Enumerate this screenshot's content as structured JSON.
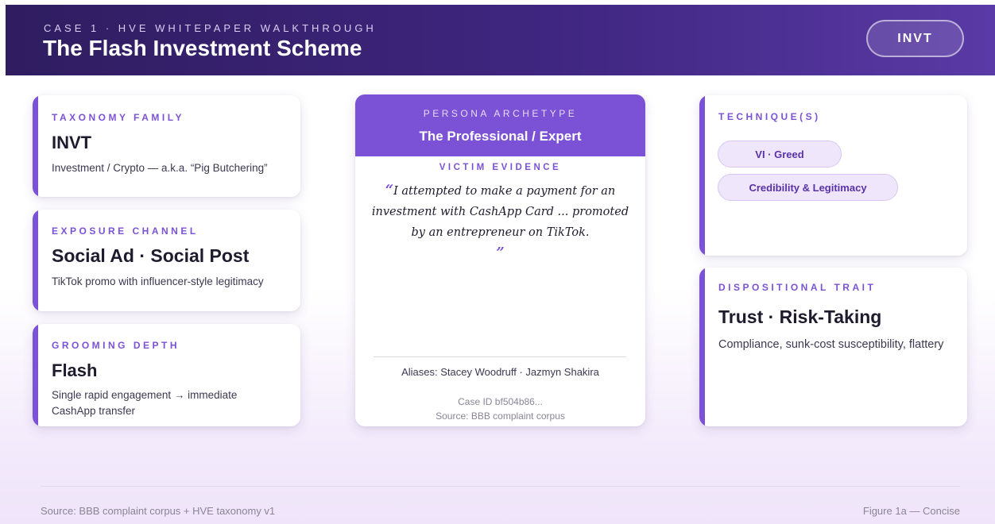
{
  "header": {
    "kicker": "CASE 1 · HVE WHITEPAPER WALKTHROUGH",
    "title": "The Flash Investment Scheme",
    "badge": "INVT"
  },
  "taxonomy": {
    "label": "TAXONOMY FAMILY",
    "value": "INVT",
    "desc": "Investment / Crypto — a.k.a. “Pig Butchering”"
  },
  "exposure": {
    "label": "EXPOSURE CHANNEL",
    "value": "Social Ad · Social Post",
    "desc": "TikTok promo with influencer-style legitimacy"
  },
  "grooming": {
    "label": "GROOMING DEPTH",
    "value": "Flash",
    "desc": "Single rapid engagement → immediate CashApp transfer"
  },
  "persona": {
    "label": "PERSONA ARCHETYPE",
    "name": "The Professional / Expert",
    "evidence_label": "VICTIM EVIDENCE",
    "open_quote": "“",
    "quote": "I attempted to make a payment for an investment with CashApp Card ... promoted by an entrepreneur on TikTok.",
    "close_quote": "”",
    "aliases": "Aliases: Stacey Woodruff · Jazmyn Shakira",
    "case_id": "Case ID bf504b86...",
    "source": "Source: BBB complaint corpus"
  },
  "techniques": {
    "label": "TECHNIQUE(S)",
    "chips": [
      "VI · Greed",
      "Credibility & Legitimacy"
    ]
  },
  "trait": {
    "label": "DISPOSITIONAL TRAIT",
    "value": "Trust · Risk-Taking",
    "desc": "Compliance, sunk-cost susceptibility, flattery"
  },
  "footer": {
    "source": "Source: BBB complaint corpus + HVE taxonomy v1",
    "figure": "Figure 1a — Concise"
  },
  "colors": {
    "accent": "#7b52d6",
    "header_dark": "#2f1d60",
    "header_light": "#5a3aa6"
  }
}
